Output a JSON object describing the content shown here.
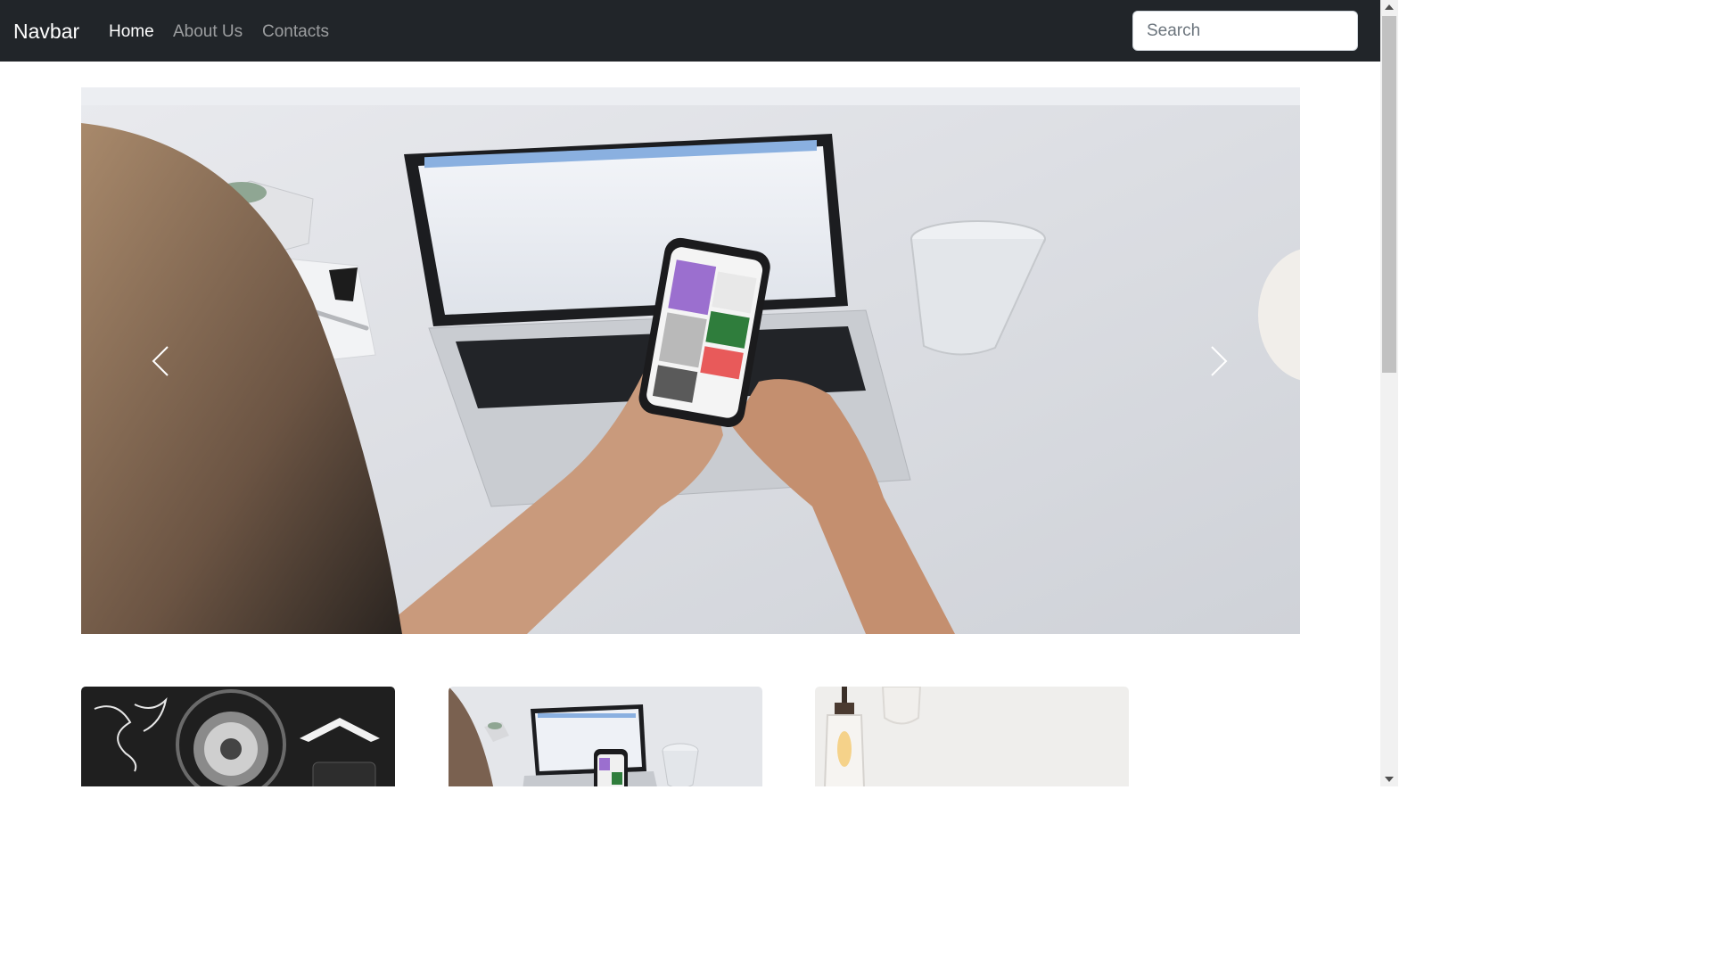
{
  "navbar": {
    "brand": "Navbar",
    "links": [
      {
        "label": "Home",
        "active": true
      },
      {
        "label": "About Us",
        "active": false
      },
      {
        "label": "Contacts",
        "active": false
      }
    ],
    "search_placeholder": "Search"
  },
  "carousel": {
    "image": "photo-person-using-phone-at-laptop-desk",
    "prev_icon": "chevron-left-icon",
    "next_icon": "chevron-right-icon"
  },
  "cards": [
    {
      "image": "photo-dark-flatlay-objects"
    },
    {
      "image": "photo-person-using-phone-at-laptop-desk"
    },
    {
      "image": "photo-hanging-light-bulbs"
    }
  ],
  "colors": {
    "navbar_bg": "#212529",
    "nav_active": "#ffffff",
    "nav_inactive": "rgba(255,255,255,0.55)"
  }
}
